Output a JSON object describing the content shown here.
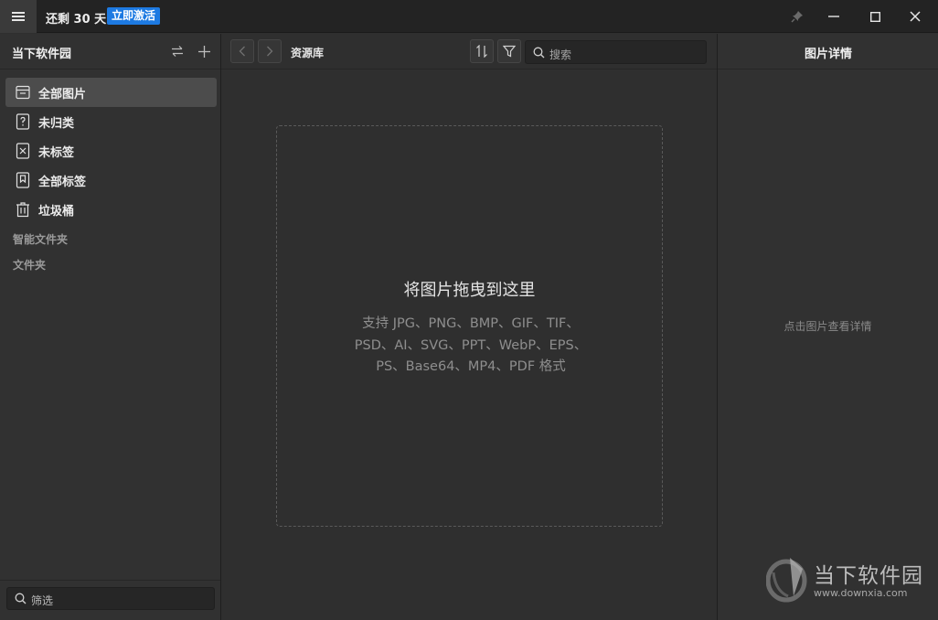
{
  "titlebar": {
    "menu_icon": "hamburger-icon",
    "trial_text": "还剩 30 天",
    "activate_label": "立即激活",
    "pin_icon": "pin-icon",
    "minimize_icon": "minimize-icon",
    "maximize_icon": "maximize-icon",
    "close_icon": "close-icon"
  },
  "sidebar": {
    "title": "当下软件园",
    "switch_icon": "switch-icon",
    "add_icon": "plus-icon",
    "items": [
      {
        "label": "全部图片",
        "icon": "inbox-icon",
        "active": true
      },
      {
        "label": "未归类",
        "icon": "question-file-icon",
        "active": false
      },
      {
        "label": "未标签",
        "icon": "untagged-icon",
        "active": false
      },
      {
        "label": "全部标签",
        "icon": "bookmark-icon",
        "active": false
      },
      {
        "label": "垃圾桶",
        "icon": "trash-icon",
        "active": false
      }
    ],
    "smart_folders_label": "智能文件夹",
    "folders_label": "文件夹",
    "filter_placeholder": "筛选"
  },
  "main": {
    "breadcrumb": "资源库",
    "search_placeholder": "搜索",
    "dropzone_title": "将图片拖曳到这里",
    "dropzone_formats": "支持 JPG、PNG、BMP、GIF、TIF、PSD、AI、SVG、PPT、WebP、EPS、PS、Base64、MP4、PDF 格式"
  },
  "details": {
    "title": "图片详情",
    "empty_text": "点击图片查看详情"
  },
  "watermark": {
    "cn": "当下软件园",
    "url": "www.downxia.com"
  },
  "colors": {
    "accent": "#1d7ae2",
    "background": "#2f2f2f",
    "panel": "#313131"
  }
}
